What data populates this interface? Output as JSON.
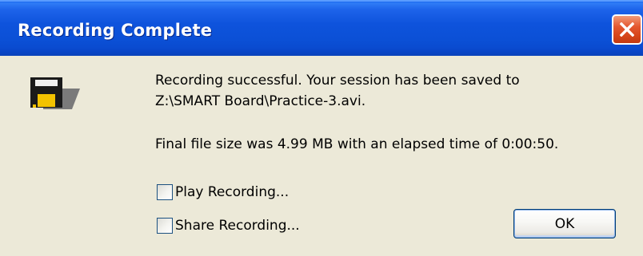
{
  "window": {
    "title": "Recording Complete",
    "close_icon": "close-icon",
    "colors": {
      "titlebar": "#0b50d6",
      "client": "#ece9d8",
      "close_button": "#e4572f"
    }
  },
  "dialog": {
    "icon": "floppy-disk-icon",
    "message_line1": "Recording successful.  Your session has been saved to",
    "message_line2": "Z:\\SMART Board\\Practice-3.avi.",
    "message_line3": "Final file size was 4.99 MB with an elapsed time of 0:00:50.",
    "play_recording": {
      "label": "Play Recording...",
      "checked": false
    },
    "share_recording": {
      "label": "Share Recording...",
      "checked": false
    },
    "ok_label": "OK"
  }
}
